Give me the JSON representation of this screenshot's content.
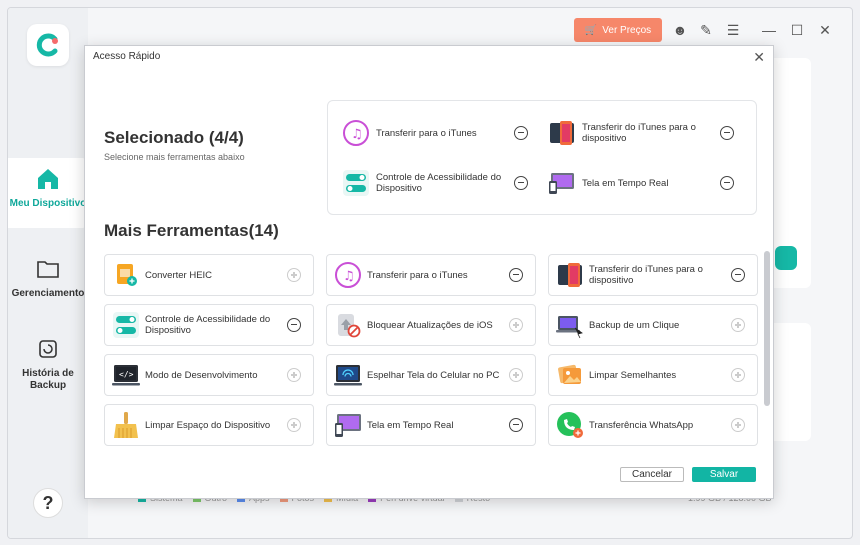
{
  "app": {
    "price_button": "Ver Preços",
    "nav": [
      {
        "label": "Meu Dispositivo"
      },
      {
        "label": "Gerenciamento"
      },
      {
        "label": "História de Backup"
      }
    ],
    "help": "?",
    "legend": [
      "Sistema",
      "Outro",
      "Apps",
      "Fotos",
      "Mídia",
      "Pen drive virtual",
      "Resto"
    ],
    "storage": "1.99 GB / 128.00 GB"
  },
  "dialog": {
    "title": "Acesso Rápido",
    "selected_heading": "Selecionado (4/4)",
    "selected_sub": "Selecione mais ferramentas abaixo",
    "selected": [
      {
        "label": "Transferir para o iTunes",
        "icon": "itunes-icon"
      },
      {
        "label": "Transferir do iTunes para o dispositivo",
        "icon": "iphone-icon"
      },
      {
        "label": "Controle de Acessibilidade do Dispositivo",
        "icon": "toggle-icon"
      },
      {
        "label": "Tela em Tempo Real",
        "icon": "screen-mirror-icon"
      }
    ],
    "more_heading": "Mais Ferramentas(14)",
    "tools": [
      {
        "label": "Converter HEIC",
        "icon": "heic-icon",
        "selected": false
      },
      {
        "label": "Transferir para o iTunes",
        "icon": "itunes-icon",
        "selected": true
      },
      {
        "label": "Transferir do iTunes para o dispositivo",
        "icon": "iphone-icon",
        "selected": true
      },
      {
        "label": "Controle de Acessibilidade do Dispositivo",
        "icon": "toggle-icon",
        "selected": true
      },
      {
        "label": "Bloquear Atualizações de iOS",
        "icon": "block-update-icon",
        "selected": false
      },
      {
        "label": "Backup de um Clique",
        "icon": "backup-icon",
        "selected": false
      },
      {
        "label": "Modo de Desenvolvimento",
        "icon": "dev-mode-icon",
        "selected": false
      },
      {
        "label": "Espelhar Tela do Celular no PC",
        "icon": "mirror-phone-icon",
        "selected": false
      },
      {
        "label": "Limpar Semelhantes",
        "icon": "similar-photos-icon",
        "selected": false
      },
      {
        "label": "Limpar Espaço do Dispositivo",
        "icon": "broom-icon",
        "selected": false
      },
      {
        "label": "Tela em Tempo Real",
        "icon": "screen-mirror-icon",
        "selected": true
      },
      {
        "label": "Transferência WhatsApp",
        "icon": "whatsapp-icon",
        "selected": false
      }
    ],
    "cancel": "Cancelar",
    "save": "Salvar"
  }
}
